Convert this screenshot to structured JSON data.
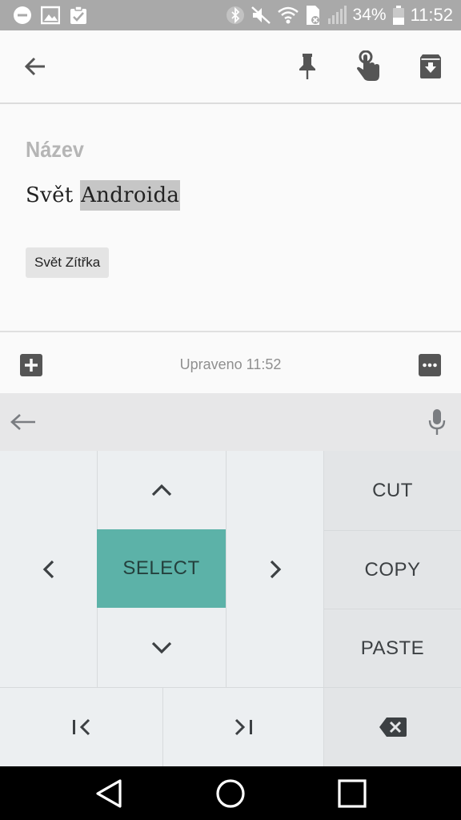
{
  "status_bar": {
    "battery_percent": "34%",
    "time": "11:52",
    "left_icons": [
      "minus-circle-icon",
      "image-icon",
      "clipboard-check-icon"
    ],
    "right_icons": [
      "bluetooth-icon",
      "mute-icon",
      "wifi-icon",
      "sim-icon",
      "signal-icon",
      "battery-icon"
    ]
  },
  "toolbar": {
    "icons": [
      "back-arrow-icon",
      "pin-icon",
      "reminder-icon",
      "archive-icon"
    ]
  },
  "note": {
    "title_placeholder": "Název",
    "body_plain": "Svět ",
    "body_selected": "Androida",
    "label_chip": "Svět Zítřka"
  },
  "note_bar": {
    "edited_text": "Upraveno 11:52",
    "icons": [
      "add-box-icon",
      "more-options-icon"
    ]
  },
  "keyboard": {
    "top_icons": [
      "keyboard-back-icon",
      "microphone-icon"
    ],
    "select_label": "SELECT",
    "cut_label": "CUT",
    "copy_label": "COPY",
    "paste_label": "PASTE",
    "nav_icons": [
      "up-chevron-icon",
      "down-chevron-icon",
      "left-chevron-icon",
      "right-chevron-icon",
      "line-start-icon",
      "line-end-icon",
      "backspace-icon"
    ],
    "select_color": "#5cb2a8"
  },
  "nav_bar": {
    "icons": [
      "back-triangle-icon",
      "home-circle-icon",
      "recents-square-icon"
    ]
  }
}
